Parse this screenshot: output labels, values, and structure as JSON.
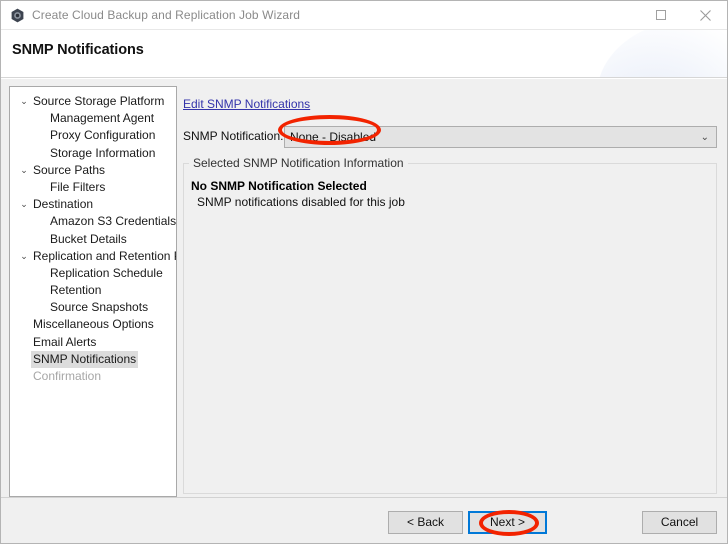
{
  "window": {
    "title": "Create Cloud Backup and Replication Job Wizard",
    "app_icon": "app-hexagon-icon",
    "controls": {
      "maximize": "maximize-icon",
      "close": "✕"
    }
  },
  "header": {
    "title": "SNMP Notifications"
  },
  "sidebar": {
    "items": [
      {
        "label": "Source Storage Platform",
        "level": 0,
        "expander": "⌄",
        "state": "normal"
      },
      {
        "label": "Management Agent",
        "level": 1,
        "expander": "",
        "state": "normal"
      },
      {
        "label": "Proxy Configuration",
        "level": 1,
        "expander": "",
        "state": "normal"
      },
      {
        "label": "Storage Information",
        "level": 1,
        "expander": "",
        "state": "normal"
      },
      {
        "label": "Source Paths",
        "level": 0,
        "expander": "⌄",
        "state": "normal"
      },
      {
        "label": "File Filters",
        "level": 1,
        "expander": "",
        "state": "normal"
      },
      {
        "label": "Destination",
        "level": 0,
        "expander": "⌄",
        "state": "normal"
      },
      {
        "label": "Amazon S3 Credentials",
        "level": 1,
        "expander": "",
        "state": "normal"
      },
      {
        "label": "Bucket Details",
        "level": 1,
        "expander": "",
        "state": "normal"
      },
      {
        "label": "Replication and Retention Policy",
        "level": 0,
        "expander": "⌄",
        "state": "normal"
      },
      {
        "label": "Replication Schedule",
        "level": 1,
        "expander": "",
        "state": "normal"
      },
      {
        "label": "Retention",
        "level": 1,
        "expander": "",
        "state": "normal"
      },
      {
        "label": "Source Snapshots",
        "level": 1,
        "expander": "",
        "state": "normal"
      },
      {
        "label": "Miscellaneous Options",
        "level": 0,
        "expander": "",
        "state": "normal"
      },
      {
        "label": "Email Alerts",
        "level": 0,
        "expander": "",
        "state": "normal"
      },
      {
        "label": "SNMP Notifications",
        "level": 0,
        "expander": "",
        "state": "selected"
      },
      {
        "label": "Confirmation",
        "level": 0,
        "expander": "",
        "state": "disabled"
      }
    ]
  },
  "content": {
    "edit_link": "Edit SNMP Notifications",
    "field_label": "SNMP Notification:",
    "combo": {
      "value": "None - Disabled",
      "arrow": "⌄"
    },
    "groupbox": {
      "legend": "Selected SNMP Notification Information",
      "heading": "No SNMP Notification Selected",
      "detail": "SNMP notifications disabled for this job"
    }
  },
  "footer": {
    "back_label": "< Back",
    "next_label": "Next >",
    "cancel_label": "Cancel"
  },
  "annotations": {
    "color": "#f22300",
    "targets": [
      "combo-value",
      "next-button"
    ]
  }
}
